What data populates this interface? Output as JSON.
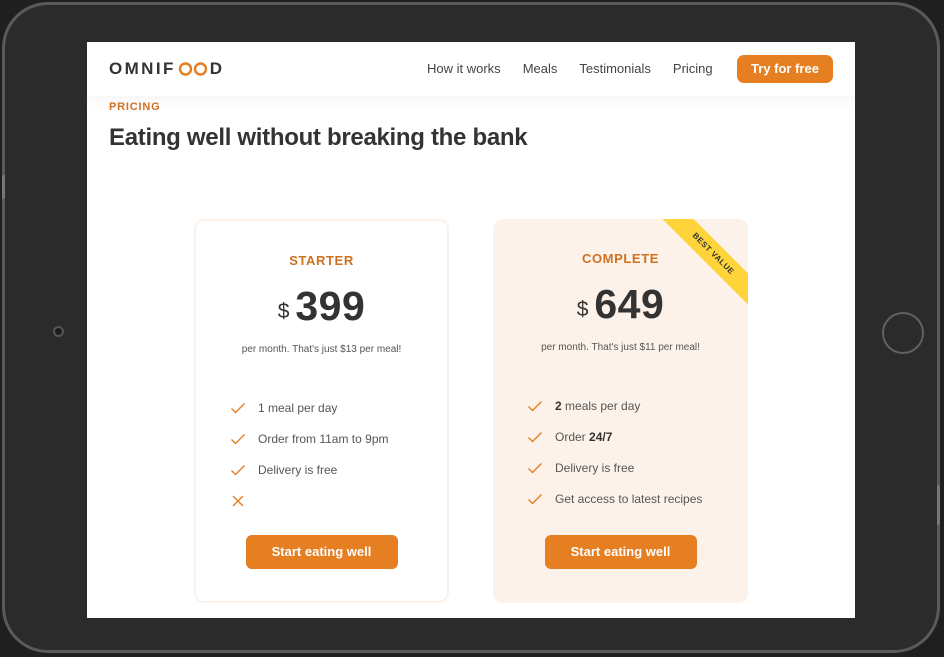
{
  "brand": {
    "logo_part1": "OMNIF",
    "logo_part2": "D",
    "accent": "#e67e22",
    "accent_dark": "#cf711f",
    "tint": "#fdf2e9",
    "ribbon_color": "#ffd43b"
  },
  "nav": {
    "links": [
      "How it works",
      "Meals",
      "Testimonials",
      "Pricing"
    ],
    "cta_label": "Try for free"
  },
  "section": {
    "subheading": "PRICING",
    "heading": "Eating well without breaking the bank"
  },
  "plans": [
    {
      "name": "STARTER",
      "currency": "$",
      "price": "399",
      "note": "per month. That's just $13 per meal!",
      "features": [
        {
          "icon": "checkmark-icon",
          "bold": "",
          "text": "1 meal per day"
        },
        {
          "icon": "checkmark-icon",
          "bold": "",
          "text": "Order from 11am to 9pm"
        },
        {
          "icon": "checkmark-icon",
          "bold": "",
          "text": "Delivery is free"
        },
        {
          "icon": "close-icon",
          "bold": "",
          "text": ""
        }
      ],
      "button_label": "Start eating well"
    },
    {
      "name": "COMPLETE",
      "currency": "$",
      "price": "649",
      "note": "per month. That's just $11 per meal!",
      "ribbon": "BEST VALUE",
      "features": [
        {
          "icon": "checkmark-icon",
          "bold": "2",
          "text": " meals per day"
        },
        {
          "icon": "checkmark-icon",
          "bold": "24/7",
          "text": "Order "
        },
        {
          "icon": "checkmark-icon",
          "bold": "",
          "text": "Delivery is free"
        },
        {
          "icon": "checkmark-icon",
          "bold": "",
          "text": "Get access to latest recipes"
        }
      ],
      "button_label": "Start eating well"
    }
  ]
}
